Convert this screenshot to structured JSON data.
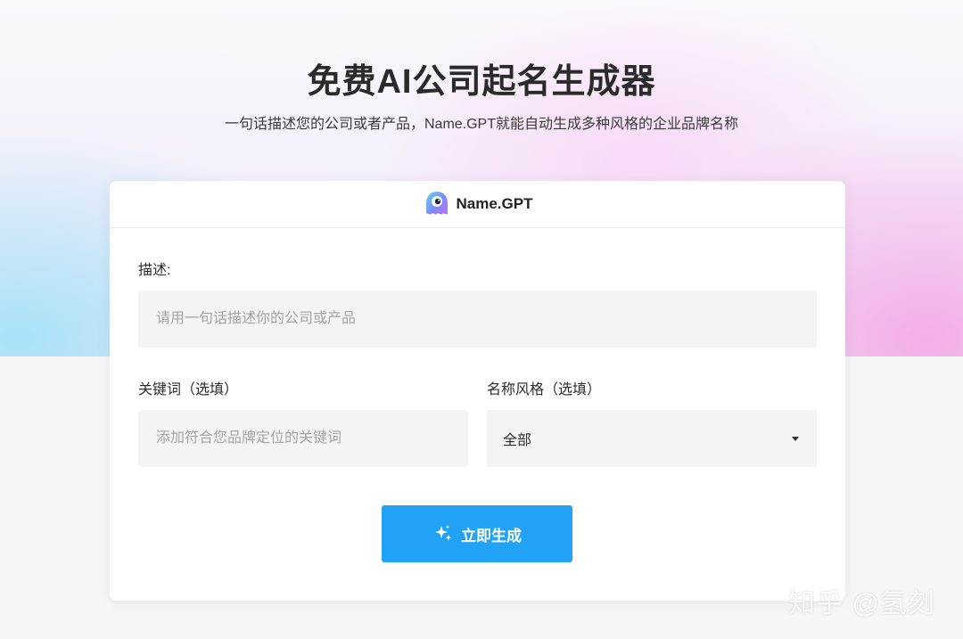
{
  "page": {
    "title": "免费AI公司起名生成器",
    "subtitle": "一句话描述您的公司或者产品，Name.GPT就能自动生成多种风格的企业品牌名称"
  },
  "card": {
    "brand_name": "Name.GPT",
    "brand_icon": "ghost-mascot-icon",
    "description": {
      "label": "描述:",
      "placeholder": "请用一句话描述你的公司或产品",
      "value": ""
    },
    "keywords": {
      "label": "关键词（选填）",
      "placeholder": "添加符合您品牌定位的关键词",
      "value": ""
    },
    "style": {
      "label": "名称风格（选填）",
      "selected": "全部"
    },
    "generate_button": {
      "label": "立即生成",
      "icon": "sparkle-icon"
    }
  },
  "watermark": "知乎 @氢刻",
  "colors": {
    "accent": "#22a2f4",
    "field_bg": "#f4f4f5",
    "hero_pink": "#f4aae6",
    "hero_blue": "#a5e1f8"
  }
}
